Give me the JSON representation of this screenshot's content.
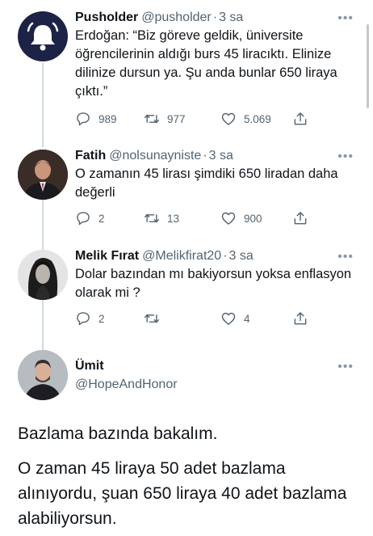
{
  "tweets": [
    {
      "name": "Pusholder",
      "handle": "@pusholder",
      "time": "3 sa",
      "text": "Erdoğan: “Biz göreve geldik, üniversite öğrencilerinin aldığı burs 45 liracıktı. Elinize dilinize dursun ya. Şu anda bunlar 650 liraya çıktı.”",
      "replies": "989",
      "retweets": "977",
      "likes": "5.069"
    },
    {
      "name": "Fatih",
      "handle": "@nolsunayniste",
      "time": "3 sa",
      "text": "O zamanın 45 lirası şimdiki 650 liradan daha değerli",
      "replies": "2",
      "retweets": "13",
      "likes": "900"
    },
    {
      "name": "Melik Fırat",
      "handle": "@Melikfirat20",
      "time": "3 sa",
      "text": "Dolar bazından mı bakiyorsun yoksa enflasyon olarak mi ?",
      "replies": "2",
      "retweets": "",
      "likes": "4"
    }
  ],
  "main_tweet": {
    "name": "Ümit",
    "handle": "@HopeAndHonor",
    "paragraph1": "Bazlama bazında bakalım.",
    "paragraph2": "O zaman 45 liraya 50 adet bazlama alınıyordu, şuan 650 liraya 40 adet bazlama alabiliyorsun."
  },
  "more_glyph": "•••",
  "colors": {
    "text": "#0f1419",
    "secondary": "#536471",
    "thread_line": "#cfd9de",
    "pusholder_avatar_bg": "#1d2346"
  }
}
